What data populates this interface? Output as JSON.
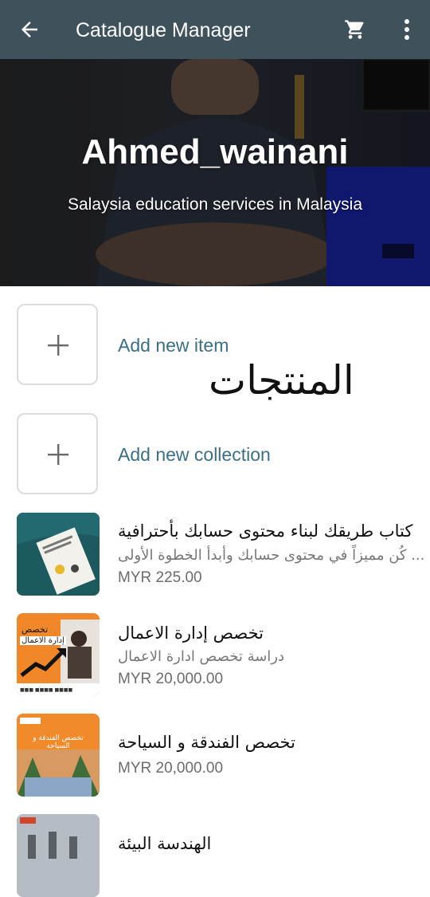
{
  "app_bar": {
    "title": "Catalogue Manager",
    "back_icon": "arrow-back-icon",
    "cart_icon": "cart-icon",
    "more_icon": "more-vert-icon"
  },
  "profile": {
    "name": "Ahmed_wainani",
    "description": "Salaysia education services in Malaysia"
  },
  "actions": {
    "add_item_label": "Add new item",
    "add_collection_label": "Add new collection"
  },
  "handwritten_note": "المنتجات",
  "products": [
    {
      "title": "كتاب طريقك لبناء محتوى حسابك بأحترافية",
      "description": "كُن مميزاً في محتوى حسابك وأبدأ الخطوة الأولى ...",
      "price": "MYR 225.00"
    },
    {
      "title": "تخصص إدارة الاعمال",
      "description": "دراسة تخصص ادارة الاعمال",
      "price": "MYR 20,000.00",
      "thumb_text_1": "تخصص",
      "thumb_text_2": "إدارة الاعمال"
    },
    {
      "title": "تخصص الفندقة و السياحة",
      "price": "MYR 20,000.00",
      "thumb_text": "تخصص الفندقة و السياحة"
    },
    {
      "title": "الهندسة البيئة"
    }
  ],
  "colors": {
    "app_bar": "#3f525c",
    "accent_link": "#3a6f86",
    "price_gray": "#6c6c6c"
  }
}
